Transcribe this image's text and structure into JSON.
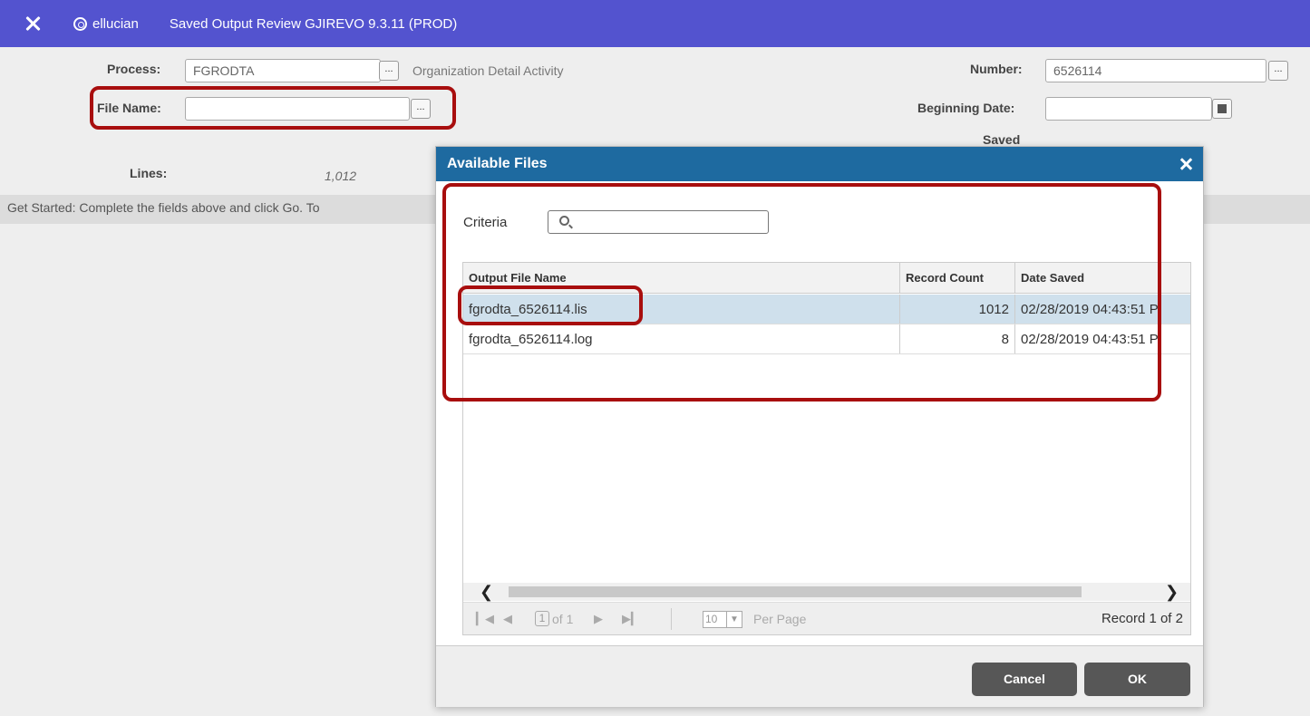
{
  "app": {
    "brand": "ellucian",
    "title": "Saved Output Review GJIREVO 9.3.11 (PROD)"
  },
  "form": {
    "process_label": "Process:",
    "process_value": "FGRODTA",
    "process_desc": "Organization Detail Activity",
    "file_name_label": "File Name:",
    "file_name_value": "",
    "lines_label": "Lines:",
    "lines_value": "1,012",
    "number_label": "Number:",
    "number_value": "6526114",
    "beginning_date_label": "Beginning Date:",
    "beginning_date_value": "",
    "saved_label": "Saved",
    "lookup_label": "...",
    "info_text": "Get Started: Complete the fields above and click Go. To"
  },
  "modal": {
    "title": "Available Files",
    "criteria_label": "Criteria",
    "criteria_value": "",
    "columns": [
      "Output File Name",
      "Record Count",
      "Date Saved"
    ],
    "rows": [
      {
        "name": "fgrodta_6526114.lis",
        "count": "1012",
        "date": "02/28/2019 04:43:51 P",
        "selected": true
      },
      {
        "name": "fgrodta_6526114.log",
        "count": "8",
        "date": "02/28/2019 04:43:51 P",
        "selected": false
      }
    ],
    "pager": {
      "page": "1",
      "of_text": "of 1",
      "per_page_value": "10",
      "per_page_label": "Per Page",
      "record_text": "Record 1 of 2"
    },
    "cancel_label": "Cancel",
    "ok_label": "OK"
  },
  "colors": {
    "titlebar": "#5353cf",
    "modal_header": "#1e6aa0",
    "selected_row": "#cfe0ec",
    "annotation": "#a80e0e",
    "button": "#575757"
  }
}
